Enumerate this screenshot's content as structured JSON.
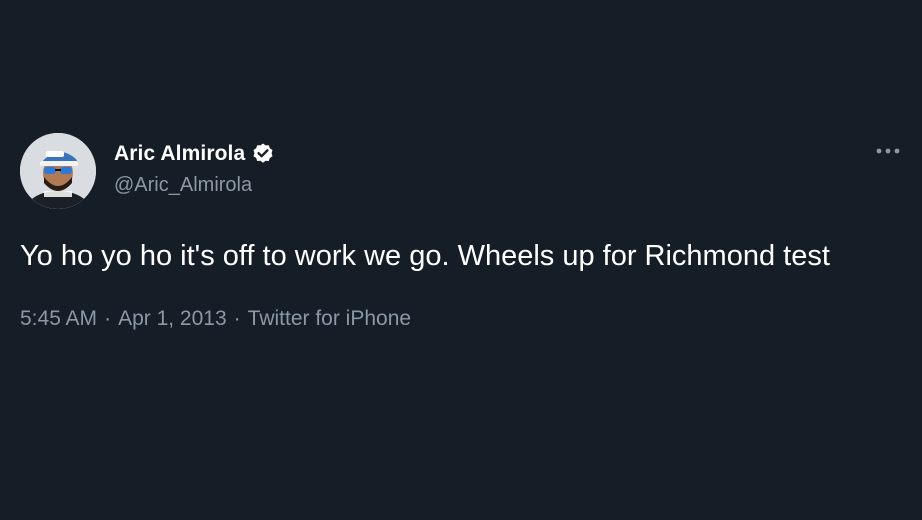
{
  "tweet": {
    "display_name": "Aric Almirola",
    "handle": "@Aric_Almirola",
    "text": "Yo ho yo ho it's off to work we go. Wheels up for Richmond test",
    "time": "5:45 AM",
    "separator": "·",
    "date": "Apr 1, 2013",
    "source": "Twitter for iPhone",
    "verified": true
  },
  "icons": {
    "verified": "verified-badge-icon",
    "more": "more-horizontal-icon"
  },
  "colors": {
    "background": "#151d27",
    "text_primary": "#ffffff",
    "text_secondary": "#8b98a5"
  }
}
